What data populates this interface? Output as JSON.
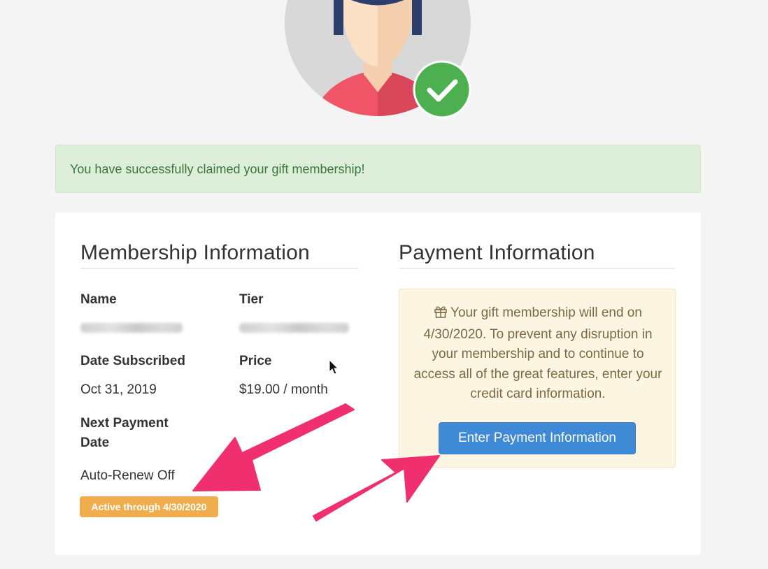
{
  "alert": {
    "message": "You have successfully claimed your gift membership!"
  },
  "membership": {
    "title": "Membership Information",
    "name_label": "Name",
    "tier_label": "Tier",
    "date_subscribed_label": "Date Subscribed",
    "date_subscribed_value": "Oct 31, 2019",
    "price_label": "Price",
    "price_value": "$19.00 / month",
    "next_payment_label": "Next Payment Date",
    "next_payment_value": "Auto-Renew Off",
    "status_badge": "Active through 4/30/2020"
  },
  "payment": {
    "title": "Payment Information",
    "notice": "Your gift membership will end on 4/30/2020. To prevent any disruption in your membership and to continue to access all of the great features, enter your credit card information.",
    "button_label": "Enter Payment Information"
  },
  "icons": {
    "avatar": "user-avatar",
    "check": "check-icon",
    "gift": "gift-icon",
    "cursor": "mouse-cursor-icon",
    "annotation": "pink-arrow-icon"
  },
  "colors": {
    "success_bg": "#ddefd8",
    "success_text": "#3c763d",
    "badge": "#f0ad4e",
    "primary_button": "#3f8ad6",
    "notice_bg": "#fcf5e2",
    "annotation_arrow": "#f0306e",
    "check_badge": "#4caf50"
  }
}
